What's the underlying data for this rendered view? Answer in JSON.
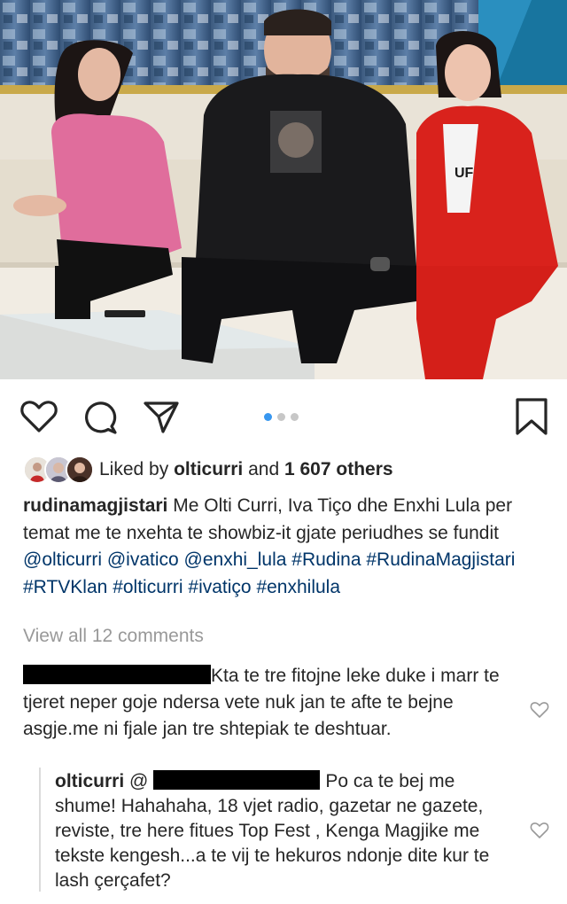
{
  "post": {
    "photo": {
      "people": [
        "woman-pink-dress",
        "man-black-hoodie",
        "woman-red-suit"
      ],
      "shirt_text": "UF"
    },
    "carousel": {
      "total": 3,
      "current": 1
    },
    "likes": {
      "prefix": "Liked by",
      "user": "olticurri",
      "middle": "and",
      "count": "1 607 others"
    },
    "caption": {
      "user": "rudinamagjistari",
      "text": "Me Olti Curri, Iva Tiço dhe Enxhi Lula per temat me te nxehta te showbiz-it gjate periudhes se fundit",
      "mentions": [
        "@olticurri",
        "@ivatico",
        "@enxhi_lula"
      ],
      "hashtags": [
        "#Rudina",
        "#RudinaMagjistari",
        "#RTVKlan",
        "#olticurri",
        "#ivatiço",
        "#enxhilula"
      ]
    },
    "view_all": "View all 12 comments"
  },
  "comments": [
    {
      "user": "",
      "text": "Kta te tre fitojne leke duke i marr te tjeret neper goje ndersa vete nuk jan te afte te bejne asgje.me ni fjale jan tre shtepiak te deshtuar."
    },
    {
      "user": "olticurri",
      "mention_prefix": "@",
      "text": "Po ca te bej me shume! Hahahaha, 18 vjet radio, gazetar ne gazete, reviste, tre here fitues Top Fest , Kenga Magjike me tekste kengesh...a te vij te hekuros ndonje dite kur te lash çerçafet?"
    }
  ],
  "colors": {
    "accent": "#3897f0",
    "link": "#003569",
    "muted": "#999999",
    "text": "#262626"
  },
  "icons": [
    "heart-icon",
    "comment-icon",
    "share-icon",
    "bookmark-icon",
    "heart-small-icon"
  ]
}
